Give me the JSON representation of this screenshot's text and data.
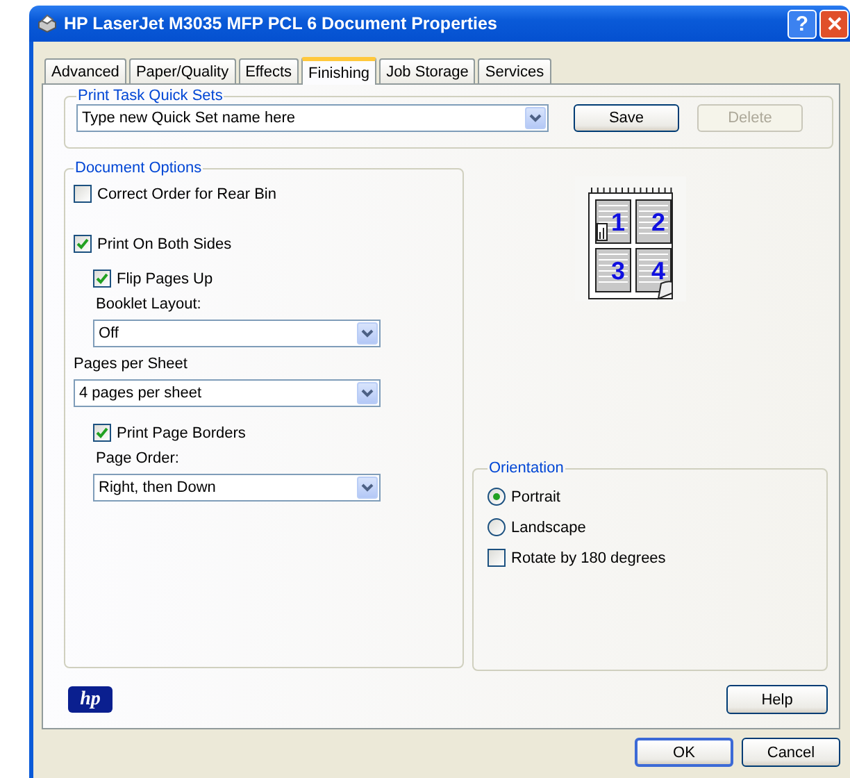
{
  "window": {
    "title": "HP LaserJet M3035 MFP PCL 6 Document Properties",
    "help_button": "?"
  },
  "tabs": [
    {
      "label": "Advanced",
      "selected": false
    },
    {
      "label": "Paper/Quality",
      "selected": false
    },
    {
      "label": "Effects",
      "selected": false
    },
    {
      "label": "Finishing",
      "selected": true
    },
    {
      "label": "Job Storage",
      "selected": false
    },
    {
      "label": "Services",
      "selected": false
    }
  ],
  "quick_sets": {
    "legend": "Print Task Quick Sets",
    "value": "Type new Quick Set name here",
    "buttons": [
      {
        "label": "Save",
        "disabled": false
      },
      {
        "label": "Delete",
        "disabled": true
      }
    ]
  },
  "document_options": {
    "legend": "Document Options",
    "items": [
      {
        "kind": "checkbox",
        "label": "Correct Order for Rear Bin",
        "checked": false
      },
      {
        "kind": "checkbox",
        "label": "Print On Both Sides",
        "checked": true,
        "children": [
          {
            "kind": "checkbox",
            "label": "Flip Pages Up",
            "checked": true
          },
          {
            "kind": "label",
            "label": "Booklet Layout:"
          },
          {
            "kind": "select",
            "value": "Off"
          }
        ]
      },
      {
        "kind": "label",
        "label": "Pages per Sheet"
      },
      {
        "kind": "select",
        "value": "4 pages per sheet",
        "children": [
          {
            "kind": "checkbox",
            "label": "Print Page Borders",
            "checked": true
          },
          {
            "kind": "label",
            "label": "Page Order:"
          },
          {
            "kind": "select",
            "value": "Right, then Down"
          }
        ]
      }
    ]
  },
  "preview": {
    "page_numbers": [
      "1",
      "2",
      "3",
      "4"
    ]
  },
  "orientation": {
    "legend": "Orientation",
    "options": [
      {
        "kind": "radio",
        "label": "Portrait",
        "selected": true
      },
      {
        "kind": "radio",
        "label": "Landscape",
        "selected": false
      },
      {
        "kind": "checkbox",
        "label": "Rotate by 180 degrees",
        "checked": false
      }
    ]
  },
  "logo": {
    "text": "hp"
  },
  "help_button": "Help",
  "dialog_buttons": [
    "OK",
    "Cancel"
  ]
}
